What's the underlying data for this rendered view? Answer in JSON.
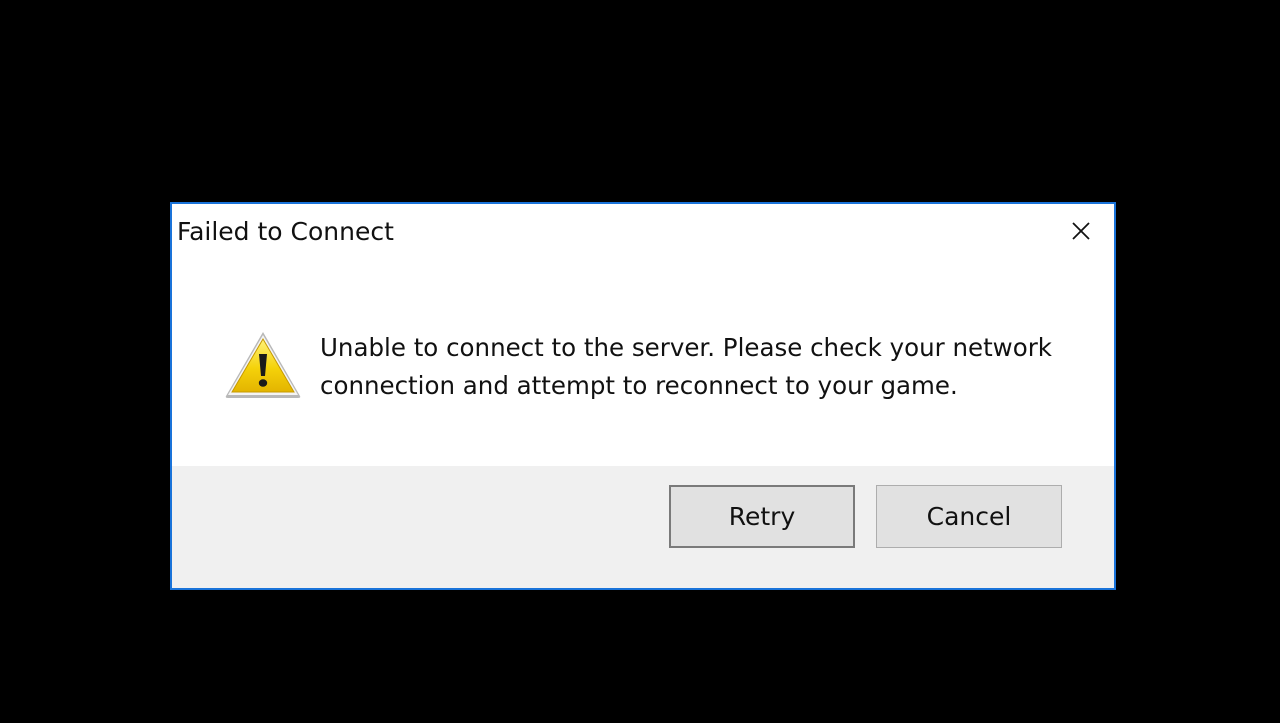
{
  "dialog": {
    "title": "Failed to Connect",
    "close_icon": "close-icon",
    "warning_icon": "warning-icon",
    "message": "Unable to connect to the server. Please check your network connection and attempt to reconnect to your game.",
    "buttons": {
      "retry_label": "Retry",
      "cancel_label": "Cancel"
    },
    "colors": {
      "border": "#1a73d9",
      "background": "#ffffff",
      "footer": "#f0f0f0",
      "button_face": "#e1e1e1",
      "screen": "#000000"
    }
  }
}
